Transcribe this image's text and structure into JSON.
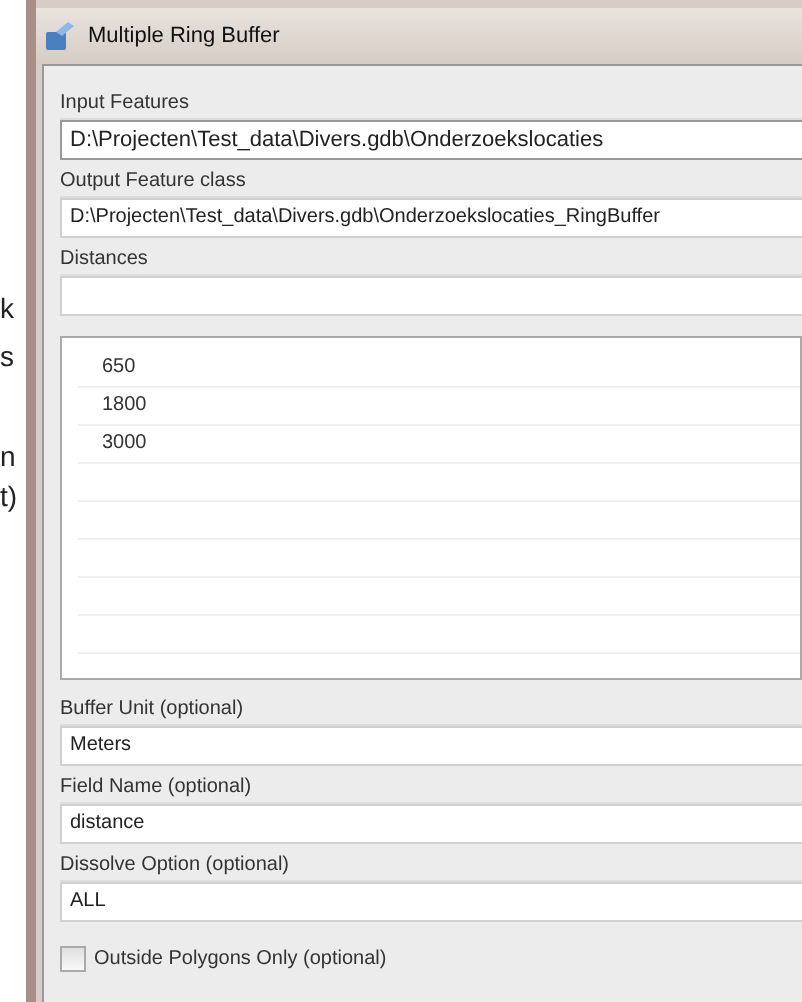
{
  "background_fragments": [
    "k",
    "s",
    "n",
    "t)"
  ],
  "window": {
    "title": "Multiple Ring Buffer"
  },
  "fields": [
    {
      "kind": "text",
      "label": "Input Features",
      "value": "D:\\Projecten\\Test_data\\Divers.gdb\\Onderzoekslocaties"
    },
    {
      "kind": "text",
      "label": "Output Feature class",
      "value": "D:\\Projecten\\Test_data\\Divers.gdb\\Onderzoekslocaties_RingBuffer"
    },
    {
      "kind": "list",
      "label": "Distances",
      "items": [
        "650",
        "1800",
        "3000"
      ]
    },
    {
      "kind": "text",
      "label": "Buffer Unit (optional)",
      "value": "Meters"
    },
    {
      "kind": "text",
      "label": "Field Name (optional)",
      "value": "distance"
    },
    {
      "kind": "text",
      "label": "Dissolve Option (optional)",
      "value": "ALL"
    },
    {
      "kind": "checkbox",
      "label": "Outside Polygons Only (optional)",
      "checked": false
    }
  ]
}
